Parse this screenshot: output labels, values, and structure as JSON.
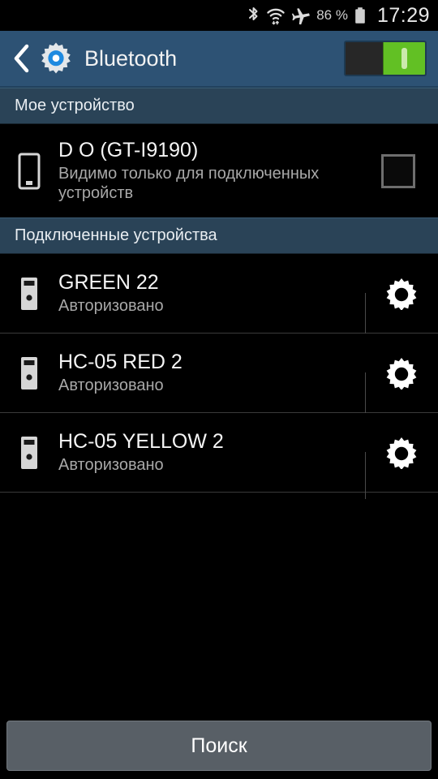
{
  "statusbar": {
    "bluetooth_icon": "bluetooth-icon",
    "wifi_icon": "wifi-icon",
    "airplane_icon": "airplane-mode-icon",
    "battery_percent": "86 %",
    "battery_icon": "battery-icon",
    "clock": "17:29"
  },
  "actionbar": {
    "back_icon": "back-chevron-icon",
    "app_icon": "settings-gear-icon",
    "title": "Bluetooth",
    "toggle": {
      "name": "bluetooth-toggle",
      "state": "on",
      "on_color": "#62c024",
      "off_color": "#272727"
    }
  },
  "sections": [
    {
      "id": "my-device",
      "title": "Мое устройство",
      "rows": [
        {
          "icon": "phone-icon",
          "title": "D O (GT-I9190)",
          "subtitle": "Видимо только для подключенных устройств",
          "checkbox": {
            "name": "visibility-checkbox",
            "checked": false
          }
        }
      ]
    },
    {
      "id": "paired-devices",
      "title": "Подключенные устройства",
      "rows": [
        {
          "icon": "bluetooth-device-icon",
          "title": "GREEN 22",
          "subtitle": "Авторизовано",
          "settings_icon": "gear-icon"
        },
        {
          "icon": "bluetooth-device-icon",
          "title": "HC-05 RED 2",
          "subtitle": "Авторизовано",
          "settings_icon": "gear-icon"
        },
        {
          "icon": "bluetooth-device-icon",
          "title": "HC-05 YELLOW 2",
          "subtitle": "Авторизовано",
          "settings_icon": "gear-icon"
        }
      ]
    }
  ],
  "bottom": {
    "search_label": "Поиск"
  },
  "colors": {
    "actionbar": "#2d5274",
    "section_header": "#2a4357",
    "background": "#000000",
    "accent_blue": "#1e8ae0",
    "toggle_green": "#62c024",
    "button_gray": "#585f66"
  }
}
